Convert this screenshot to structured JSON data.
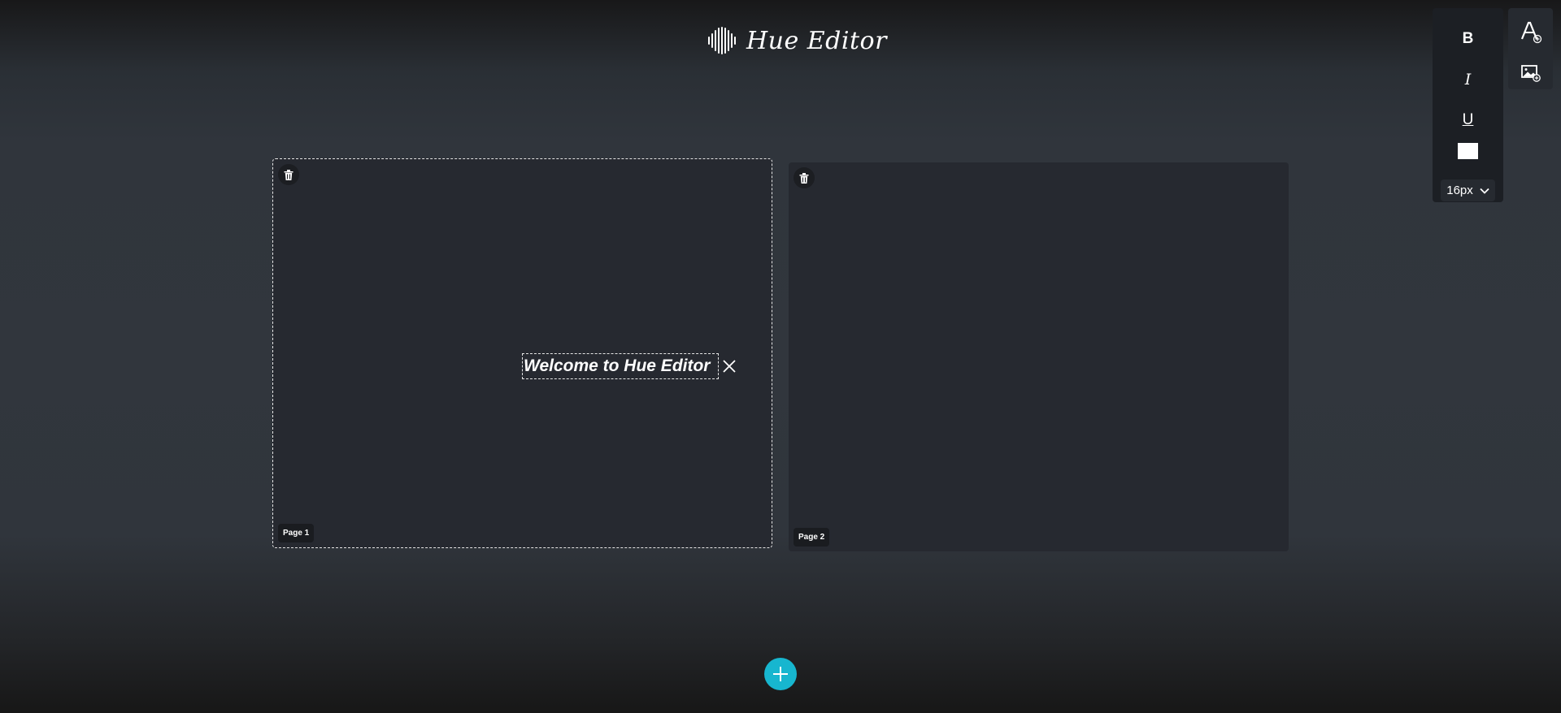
{
  "header": {
    "app_name": "Hue Editor",
    "logo_icon": "soundwave-logo-icon"
  },
  "pages": [
    {
      "label": "Page 1",
      "selected": true,
      "delete_icon": "trash-icon",
      "text_elements": [
        {
          "text": "Welcome to Hue Editor",
          "bold": true,
          "italic": true,
          "remove_icon": "close-icon"
        }
      ]
    },
    {
      "label": "Page 2",
      "selected": false,
      "delete_icon": "trash-icon"
    }
  ],
  "format_toolbar": {
    "bold_label": "B",
    "italic_label": "I",
    "underline_label": "U",
    "text_color": "#ffffff",
    "font_size": "16px",
    "font_size_icon": "chevron-down-icon"
  },
  "insert_toolbar": {
    "add_text_icon": "add-text-icon",
    "add_image_icon": "add-image-icon"
  },
  "add_page_icon": "plus-icon",
  "colors": {
    "accent": "#17b6cf",
    "page_bg": "#262930",
    "toolbar_bg": "#1c1f24"
  }
}
